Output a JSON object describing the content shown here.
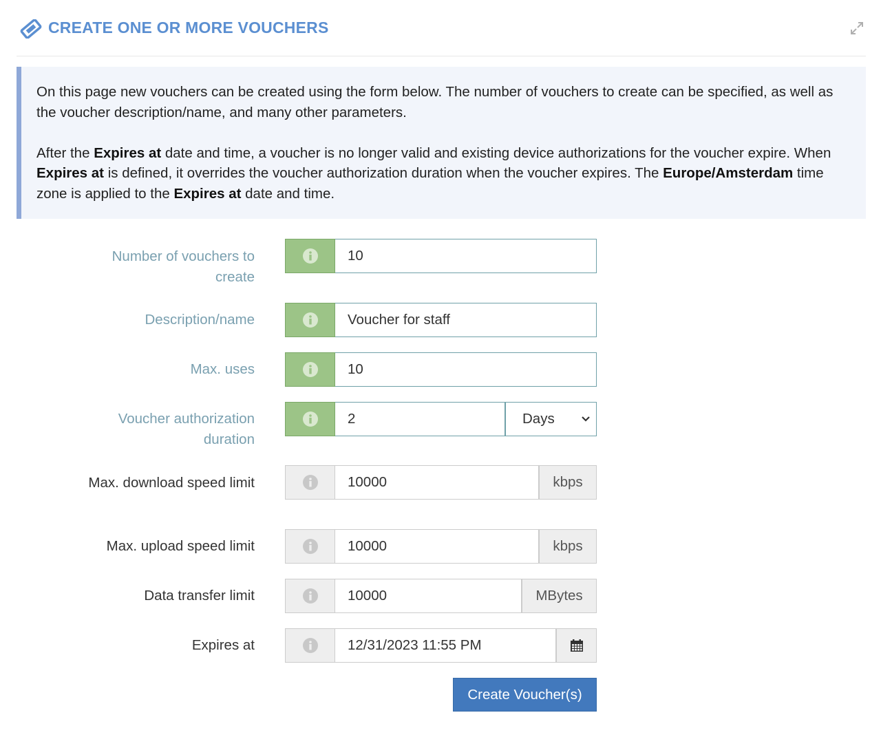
{
  "header": {
    "title": "CREATE ONE OR MORE VOUCHERS",
    "icon": "ticket-icon",
    "expand_icon": "expand-icon"
  },
  "info": {
    "p1": "On this page new vouchers can be created using the form below. The number of vouchers to create can be specified, as well as the voucher description/name, and many other parameters.",
    "p2_a": "After the ",
    "p2_b": "Expires at",
    "p2_c": " date and time, a voucher is no longer valid and existing device authorizations for the voucher expire. When ",
    "p2_d": "Expires at",
    "p2_e": " is defined, it overrides the voucher authorization duration when the voucher expires. The ",
    "p2_f": "Europe/Amsterdam",
    "p2_g": " time zone is applied to the ",
    "p2_h": "Expires at",
    "p2_i": " date and time."
  },
  "form": {
    "num_vouchers": {
      "label": "Number of vouchers to create",
      "value": "10"
    },
    "description": {
      "label": "Description/name",
      "value": "Voucher for staff"
    },
    "max_uses": {
      "label": "Max. uses",
      "value": "10"
    },
    "duration": {
      "label": "Voucher authorization duration",
      "value": "2",
      "unit": "Days"
    },
    "download": {
      "label": "Max. download speed limit",
      "value": "10000",
      "unit": "kbps"
    },
    "upload": {
      "label": "Max. upload speed limit",
      "value": "10000",
      "unit": "kbps"
    },
    "data_transfer": {
      "label": "Data transfer limit",
      "value": "10000",
      "unit": "MBytes"
    },
    "expires": {
      "label": "Expires at",
      "value": "12/31/2023 11:55 PM"
    },
    "submit_label": "Create Voucher(s)"
  },
  "colors": {
    "title": "#5b8fd1",
    "required_label": "#7aa0b0",
    "required_addon": "#9cc487",
    "button": "#4279bd",
    "info_bg": "#f2f5fb",
    "info_border": "#8fa8d8"
  }
}
